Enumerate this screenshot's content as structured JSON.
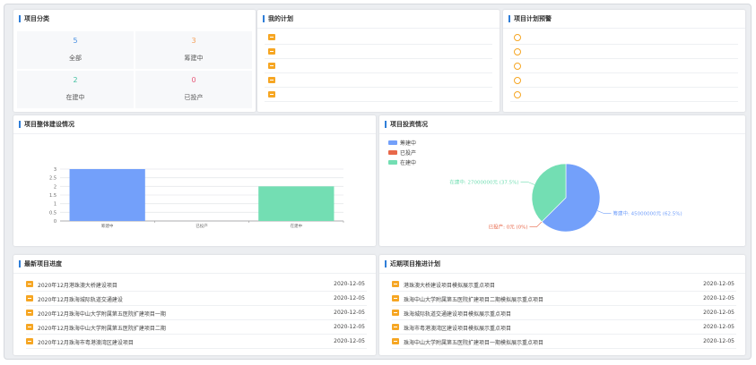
{
  "category": {
    "title": "项目分类",
    "cells": [
      {
        "count": "5",
        "label": "全部",
        "color": "#4a90e2"
      },
      {
        "count": "3",
        "label": "筹建中",
        "color": "#f5a05a"
      },
      {
        "count": "2",
        "label": "在建中",
        "color": "#3fbf9f"
      },
      {
        "count": "0",
        "label": "已投产",
        "color": "#e85a7a"
      }
    ]
  },
  "plan": {
    "title": "我的计划",
    "rows": 5
  },
  "warning": {
    "title": "项目计划预警",
    "rows": 5
  },
  "construction": {
    "title": "项目整体建设情况",
    "chart_data": {
      "type": "bar",
      "categories": [
        "筹建中",
        "已投产",
        "在建中"
      ],
      "values": [
        3,
        0,
        2
      ],
      "yticks": [
        "0",
        "0.5",
        "1",
        "1.5",
        "2",
        "2.5",
        "3"
      ],
      "ylim": [
        0,
        3
      ],
      "colors": [
        "#73a0fa",
        "#e8684a",
        "#73deb3"
      ]
    }
  },
  "investment": {
    "title": "项目投资情况",
    "legend": [
      {
        "label": "筹建中",
        "color": "#73a0fa"
      },
      {
        "label": "已投产",
        "color": "#e8684a"
      },
      {
        "label": "在建中",
        "color": "#73deb3"
      }
    ],
    "chart_data": {
      "type": "pie",
      "slices": [
        {
          "label": "筹建中",
          "value": 45000000,
          "percent": 62.5,
          "text": "筹建中: 45000000元 (62.5%)",
          "color": "#73a0fa"
        },
        {
          "label": "已投产",
          "value": 0,
          "percent": 0,
          "text": "已投产: 0元 (0%)",
          "color": "#e8684a"
        },
        {
          "label": "在建中",
          "value": 27000000,
          "percent": 37.5,
          "text": "在建中: 27000000元 (37.5%)",
          "color": "#73deb3"
        }
      ]
    }
  },
  "latest": {
    "title": "最新项目进度",
    "items": [
      {
        "text": "2020年12月港珠澳大桥建设项目",
        "date": "2020-12-05"
      },
      {
        "text": "2020年12月珠海城际轨道交通建设",
        "date": "2020-12-05"
      },
      {
        "text": "2020年12月珠海中山大学附属第五医院扩建项目一期",
        "date": "2020-12-05"
      },
      {
        "text": "2020年12月珠海中山大学附属第五医院扩建项目二期",
        "date": "2020-12-05"
      },
      {
        "text": "2020年12月珠海市粤港澳湾区建设项目",
        "date": "2020-12-05"
      }
    ]
  },
  "recent": {
    "title": "近期项目推进计划",
    "items": [
      {
        "text": "港珠澳大桥建设项目模拟展示重点项目",
        "date": "2020-12-05"
      },
      {
        "text": "珠海中山大学附属第五医院扩建项目二期模拟展示重点项目",
        "date": "2020-12-05"
      },
      {
        "text": "珠海城际轨道交通建设项目模拟展示重点项目",
        "date": "2020-12-05"
      },
      {
        "text": "珠海市粤港澳湾区建设项目模拟展示重点项目",
        "date": "2020-12-05"
      },
      {
        "text": "珠海中山大学附属第五医院扩建项目一期模拟展示重点项目",
        "date": "2020-12-05"
      }
    ]
  }
}
